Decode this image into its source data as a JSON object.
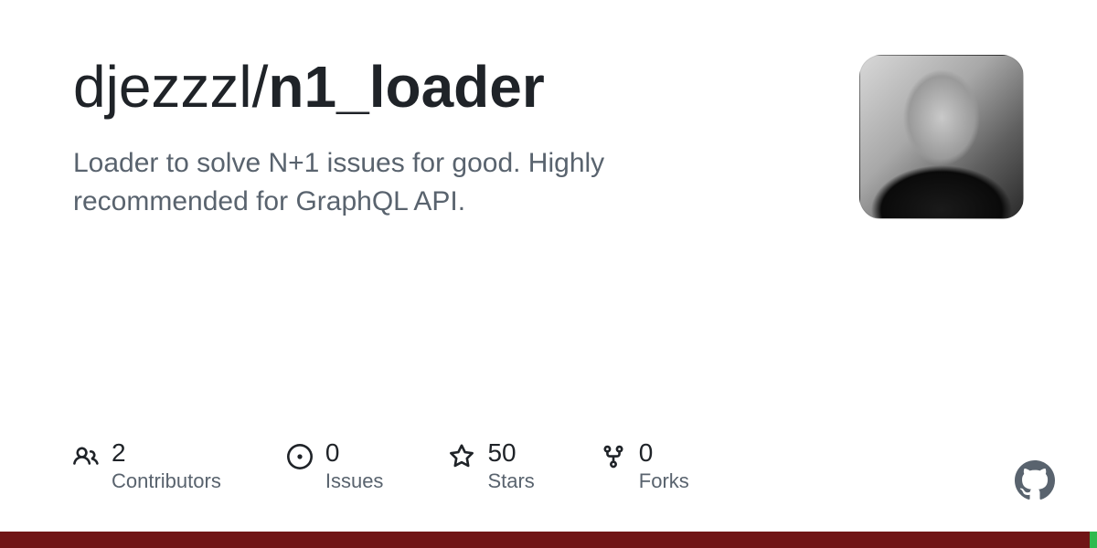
{
  "repo": {
    "owner": "djezzzl",
    "name": "n1_loader",
    "description": "Loader to solve N+1 issues for good. Highly recommended for GraphQL API."
  },
  "stats": [
    {
      "icon": "contributors-icon",
      "count": "2",
      "label": "Contributors"
    },
    {
      "icon": "issues-icon",
      "count": "0",
      "label": "Issues"
    },
    {
      "icon": "stars-icon",
      "count": "50",
      "label": "Stars"
    },
    {
      "icon": "forks-icon",
      "count": "0",
      "label": "Forks"
    }
  ],
  "languages": [
    {
      "color": "#701516",
      "percent": 99.3
    },
    {
      "color": "#2fba4e",
      "percent": 0.7
    }
  ]
}
